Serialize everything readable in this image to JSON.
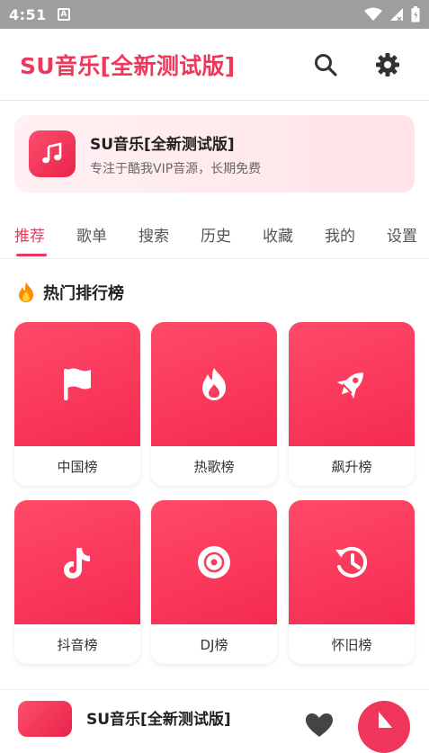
{
  "status": {
    "time": "4:51",
    "notif_icon": "A"
  },
  "header": {
    "title": "SU音乐[全新测试版]"
  },
  "banner": {
    "title": "SU音乐[全新测试版]",
    "subtitle": "专注于酷我VIP音源，长期免费"
  },
  "tabs": [
    {
      "label": "推荐",
      "active": true
    },
    {
      "label": "歌单"
    },
    {
      "label": "搜索"
    },
    {
      "label": "历史"
    },
    {
      "label": "收藏"
    },
    {
      "label": "我的"
    },
    {
      "label": "设置"
    }
  ],
  "section": {
    "title": "热门排行榜"
  },
  "charts": [
    {
      "label": "中国榜",
      "icon": "flag-icon"
    },
    {
      "label": "热歌榜",
      "icon": "flame-icon"
    },
    {
      "label": "飙升榜",
      "icon": "rocket-icon"
    },
    {
      "label": "抖音榜",
      "icon": "tiktok-icon"
    },
    {
      "label": "DJ榜",
      "icon": "disc-icon"
    },
    {
      "label": "怀旧榜",
      "icon": "history-icon"
    }
  ],
  "player": {
    "title": "SU音乐[全新测试版]"
  },
  "colors": {
    "accent": "#f0365a",
    "status_bar": "#9e9e9e"
  }
}
